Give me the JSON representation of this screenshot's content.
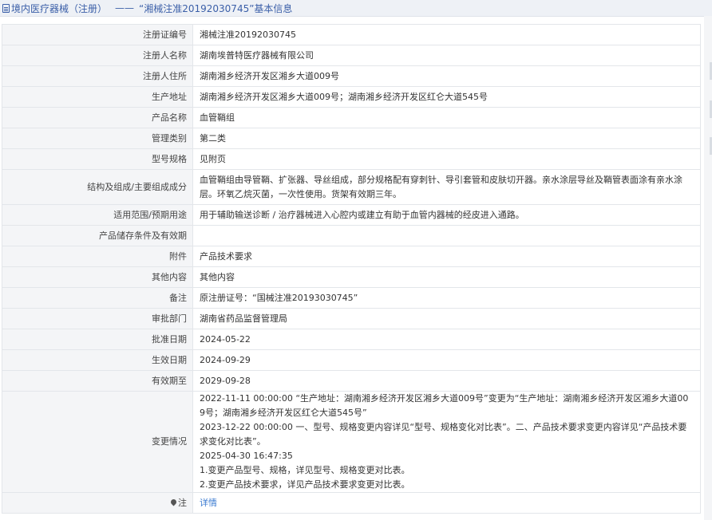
{
  "header": {
    "category": "境内医疗器械（注册）",
    "separator": "——",
    "title": "“湘械注准20192030745”基本信息"
  },
  "rows": [
    {
      "label": "注册证编号",
      "value": "湘械注准20192030745"
    },
    {
      "label": "注册人名称",
      "value": "湖南埃普特医疗器械有限公司"
    },
    {
      "label": "注册人住所",
      "value": "湖南湘乡经济开发区湘乡大道009号"
    },
    {
      "label": "生产地址",
      "value": "湖南湘乡经济开发区湘乡大道009号；湖南湘乡经济开发区红仑大道545号"
    },
    {
      "label": "产品名称",
      "value": "血管鞘组"
    },
    {
      "label": "管理类别",
      "value": "第二类"
    },
    {
      "label": "型号规格",
      "value": "见附页"
    },
    {
      "label": "结构及组成/主要组成成分",
      "value": "血管鞘组由导管鞘、扩张器、导丝组成，部分规格配有穿刺针、导引套管和皮肤切开器。亲水涂层导丝及鞘管表面涂有亲水涂层。环氧乙烷灭菌，一次性使用。货架有效期三年。"
    },
    {
      "label": "适用范围/预期用途",
      "value": "用于辅助输送诊断 / 治疗器械进入心腔内或建立有助于血管内器械的经皮进入通路。"
    },
    {
      "label": "产品储存条件及有效期",
      "value": ""
    },
    {
      "label": "附件",
      "value": "产品技术要求"
    },
    {
      "label": "其他内容",
      "value": "其他内容"
    },
    {
      "label": "备注",
      "value": "原注册证号：“国械注准20193030745”"
    },
    {
      "label": "审批部门",
      "value": "湖南省药品监督管理局"
    },
    {
      "label": "批准日期",
      "value": "2024-05-22"
    },
    {
      "label": "生效日期",
      "value": "2024-09-29"
    },
    {
      "label": "有效期至",
      "value": "2029-09-28"
    }
  ],
  "changes": {
    "label": "变更情况",
    "lines": [
      "2022-11-11 00:00:00 “生产地址：湖南湘乡经济开发区湘乡大道009号”变更为“生产地址：湖南湘乡经济开发区湘乡大道009号；湖南湘乡经济开发区红仑大道545号”",
      "2023-12-22 00:00:00 一、型号、规格变更内容详见“型号、规格变化对比表”。二、产品技术要求变更内容详见“产品技术要求变化对比表”。",
      "2025-04-30 16:47:35",
      "1.变更产品型号、规格，详见型号、规格变更对比表。",
      "2.变更产品技术要求，详见产品技术要求变更对比表。"
    ]
  },
  "note": {
    "label": "注",
    "link": "详情"
  },
  "colors": {
    "accent": "#3b5fa8",
    "link": "#3b7bd1",
    "label_bg": "#f4f5f7",
    "border": "#e3e6ea"
  }
}
